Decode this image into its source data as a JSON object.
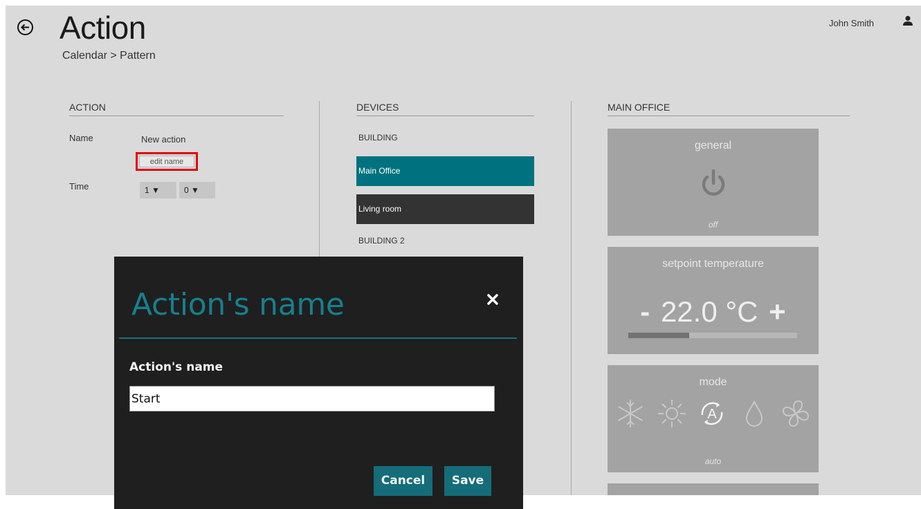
{
  "header": {
    "title": "Action",
    "breadcrumb": "Calendar > Pattern",
    "user_name": "John Smith"
  },
  "action_section": {
    "heading": "ACTION",
    "name_label": "Name",
    "name_value": "New action",
    "edit_name_label": "edit name",
    "time_label": "Time",
    "time_hour": "1 ▼",
    "time_minute": "0 ▼"
  },
  "devices_section": {
    "heading": "DEVICES",
    "groups": [
      "BUILDING",
      "BUILDING 2"
    ],
    "items": [
      {
        "label": "Main Office",
        "selected": true
      },
      {
        "label": "Living room",
        "selected": false
      }
    ]
  },
  "main_office": {
    "heading": "MAIN OFFICE",
    "general": {
      "title": "general",
      "status": "off"
    },
    "setpoint": {
      "title": "setpoint temperature",
      "minus": "-",
      "value": "22.0 °C",
      "plus": "+",
      "level": 0.36
    },
    "mode": {
      "title": "mode",
      "status": "auto",
      "icons": [
        "snowflake-icon",
        "sun-icon",
        "auto-mode-icon",
        "drop-icon",
        "fan-icon"
      ]
    }
  },
  "modal": {
    "title": "Action's name",
    "field_label": "Action's name",
    "input_value": "Start",
    "cancel_label": "Cancel",
    "save_label": "Save"
  },
  "colors": {
    "accent": "#146d79",
    "selected_device": "#00727f",
    "unselected_device": "#333333",
    "highlight": "#e00000"
  }
}
